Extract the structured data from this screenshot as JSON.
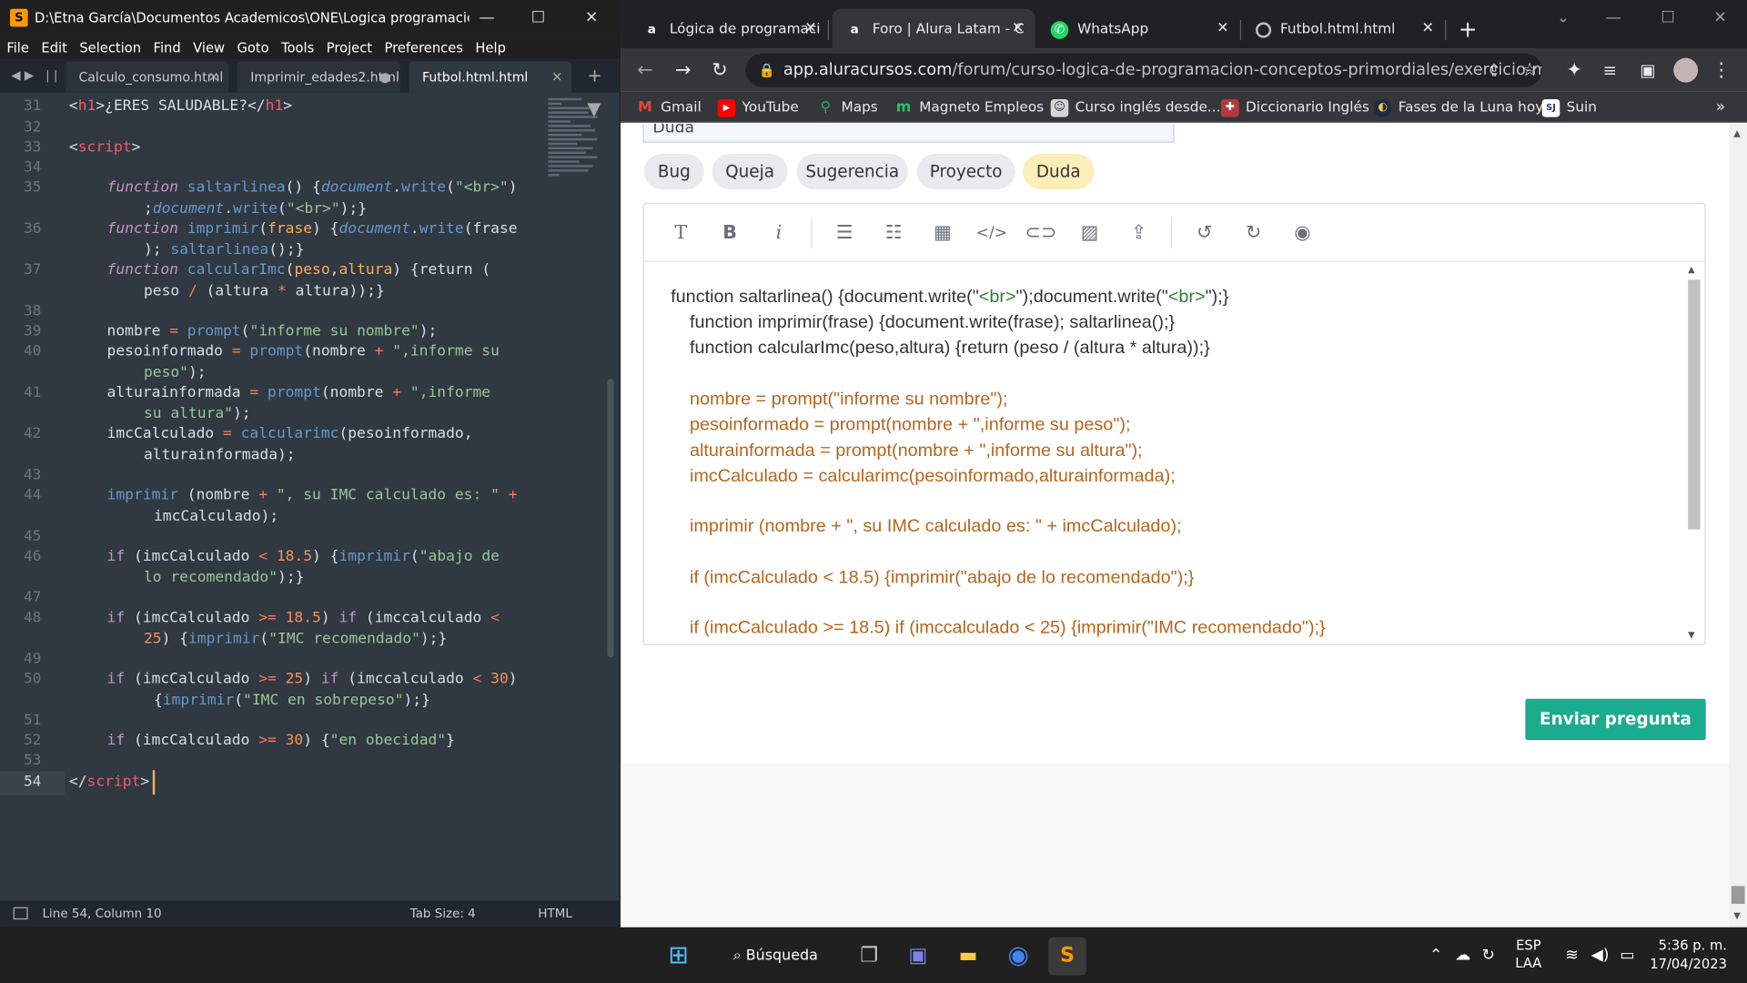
{
  "sublime": {
    "title": "D:\\Etna García\\Documentos Academicos\\ONE\\Logica programación...",
    "menu": [
      "File",
      "Edit",
      "Selection",
      "Find",
      "View",
      "Goto",
      "Tools",
      "Project",
      "Preferences",
      "Help"
    ],
    "tabs": [
      "Calculo_consumo.html",
      "Imprimir_edades2.html",
      "Futbol.html.html"
    ],
    "line_numbers": [
      "31",
      "32",
      "33",
      "34",
      "35",
      "",
      "36",
      "",
      "37",
      "",
      "38",
      "39",
      "40",
      "",
      "41",
      "",
      "42",
      "",
      "43",
      "44",
      "",
      "45",
      "46",
      "",
      "47",
      "48",
      "",
      "49",
      "50",
      "",
      "51",
      "52",
      "53",
      "54"
    ],
    "code": {
      "l31": {
        "a": "<",
        "b": "h1",
        "c": ">",
        "d": "¿ERES SALUDABLE?",
        "e": "</",
        "f": "h1",
        "g": ">"
      },
      "l33": {
        "a": "<",
        "b": "script",
        "c": ">"
      },
      "l35a": {
        "a": "function",
        "b": " saltarlinea",
        "c": "() {",
        "d": "document",
        "e": ".",
        "f": "write",
        "g": "(",
        "h": "\"<br>\"",
        "i": ")"
      },
      "l35b": {
        "a": ";",
        "b": "document",
        "c": ".",
        "d": "write",
        "e": "(",
        "f": "\"<br>\"",
        "g": ");}"
      },
      "l36a": {
        "a": "function",
        "b": " imprimir",
        "c": "(",
        "d": "frase",
        "e": ") {",
        "f": "document",
        "g": ".",
        "h": "write",
        "i": "(frase"
      },
      "l36b": {
        "a": "); ",
        "b": "saltarlinea",
        "c": "();}"
      },
      "l37a": {
        "a": "function",
        "b": " calcularImc",
        "c": "(",
        "d": "peso",
        "e": ",",
        "f": "altura",
        "g": ") {return ("
      },
      "l37b": {
        "a": "peso ",
        "b": "/",
        "c": " (altura ",
        "d": "*",
        "e": " altura));}"
      },
      "l39": {
        "a": "nombre ",
        "b": "=",
        "c": " prompt",
        "d": "(",
        "e": "\"informe su nombre\"",
        "f": ");"
      },
      "l40a": {
        "a": "pesoinformado ",
        "b": "=",
        "c": " prompt",
        "d": "(nombre ",
        "e": "+",
        "f": " \",informe su"
      },
      "l40b": {
        "a": "peso\"",
        "b": ");"
      },
      "l41a": {
        "a": "alturainformada ",
        "b": "=",
        "c": " prompt",
        "d": "(nombre ",
        "e": "+",
        "f": " \",informe"
      },
      "l41b": {
        "a": "su altura\"",
        "b": ");"
      },
      "l42a": {
        "a": "imcCalculado ",
        "b": "=",
        "c": " calcularimc",
        "d": "(pesoinformado,"
      },
      "l42b": {
        "a": "alturainformada);"
      },
      "l44a": {
        "a": "imprimir",
        "b": " (nombre ",
        "c": "+",
        "d": " \", su IMC calculado es: \"",
        "e": " +"
      },
      "l44b": {
        "a": "imcCalculado);"
      },
      "l46a": {
        "a": "if",
        "b": " (imcCalculado ",
        "c": "<",
        "d": " 18.5",
        "e": ") {",
        "f": "imprimir",
        "g": "(",
        "h": "\"abajo de"
      },
      "l46b": {
        "a": "lo recomendado\"",
        "b": ");}"
      },
      "l48a": {
        "a": "if",
        "b": " (imcCalculado ",
        "c": ">=",
        "d": " 18.5",
        "e": ") ",
        "f": "if",
        "g": " (imccalculado ",
        "h": "<"
      },
      "l48b": {
        "a": "25",
        "b": ") {",
        "c": "imprimir",
        "d": "(",
        "e": "\"IMC recomendado\"",
        "f": ");}"
      },
      "l50a": {
        "a": "if",
        "b": " (imcCalculado ",
        "c": ">=",
        "d": " 25",
        "e": ") ",
        "f": "if",
        "g": " (imccalculado ",
        "h": "<",
        "i": " 30",
        "j": ")"
      },
      "l50b": {
        "a": "{",
        "b": "imprimir",
        "c": "(",
        "d": "\"IMC en sobrepeso\"",
        "e": ");}"
      },
      "l52": {
        "a": "if",
        "b": " (imcCalculado ",
        "c": ">=",
        "d": " 30",
        "e": ") {",
        "f": "\"en obecidad\"",
        "g": "}"
      },
      "l54": {
        "a": "</",
        "b": "script",
        "c": ">"
      }
    },
    "status": {
      "position": "Line 54, Column 10",
      "tab_size": "Tab Size: 4",
      "syntax": "HTML"
    }
  },
  "chrome": {
    "tabs": [
      {
        "title": "Lógica de programaci",
        "icon": "alura-icon"
      },
      {
        "title": "Foro | Alura Latam - C",
        "icon": "alura-icon"
      },
      {
        "title": "WhatsApp",
        "icon": "whatsapp-icon"
      },
      {
        "title": "Futbol.html.html",
        "icon": "globe-icon"
      }
    ],
    "url_host": "app.aluracursos.com",
    "url_path": "/forum/curso-logica-de-programacion-conceptos-primordiales/exercicio-m...",
    "bookmarks": [
      "Gmail",
      "YouTube",
      "Maps",
      "Magneto Empleos",
      "Curso inglés desde...",
      "Diccionario Inglés",
      "Fases de la Luna hoy",
      "Suin"
    ],
    "overflow": "»"
  },
  "forum": {
    "field_value": "Duda",
    "chips": [
      "Bug",
      "Queja",
      "Sugerencia",
      "Proyecto",
      "Duda"
    ],
    "selected_chip": "Duda",
    "editor_lines": {
      "e1a": "function saltarlinea() {document.write(\"",
      "e1b": "<br>",
      "e1c": "\");document.write(\"",
      "e1d": "<br>",
      "e1e": "\");}",
      "e2": "function imprimir(frase) {document.write(frase); saltarlinea();}",
      "e3": "function calcularImc(peso,altura) {return (peso / (altura * altura));}",
      "e4": "nombre = prompt(\"informe su nombre\");",
      "e5": "pesoinformado = prompt(nombre + \",informe su peso\");",
      "e6": "alturainformada = prompt(nombre + \",informe su altura\");",
      "e7": "imcCalculado = calcularimc(pesoinformado,alturainformada);",
      "e8": "imprimir (nombre + \", su IMC calculado es: \" + imcCalculado);",
      "e9": "if (imcCalculado < 18.5) {imprimir(\"abajo de lo recomendado\");}",
      "e10": "if (imcCalculado >= 18.5) if (imccalculado < 25) {imprimir(\"IMC recomendado\");}"
    },
    "send_label": "Enviar pregunta"
  },
  "taskbar": {
    "search_label": "Búsqueda",
    "lang_top": "ESP",
    "lang_bottom": "LAA",
    "time": "5:36 p. m.",
    "date": "17/04/2023"
  },
  "colors": {
    "accent": "#1bab8e",
    "chip_selected": "#fbeeb8",
    "sublime_bg": "#303841"
  }
}
